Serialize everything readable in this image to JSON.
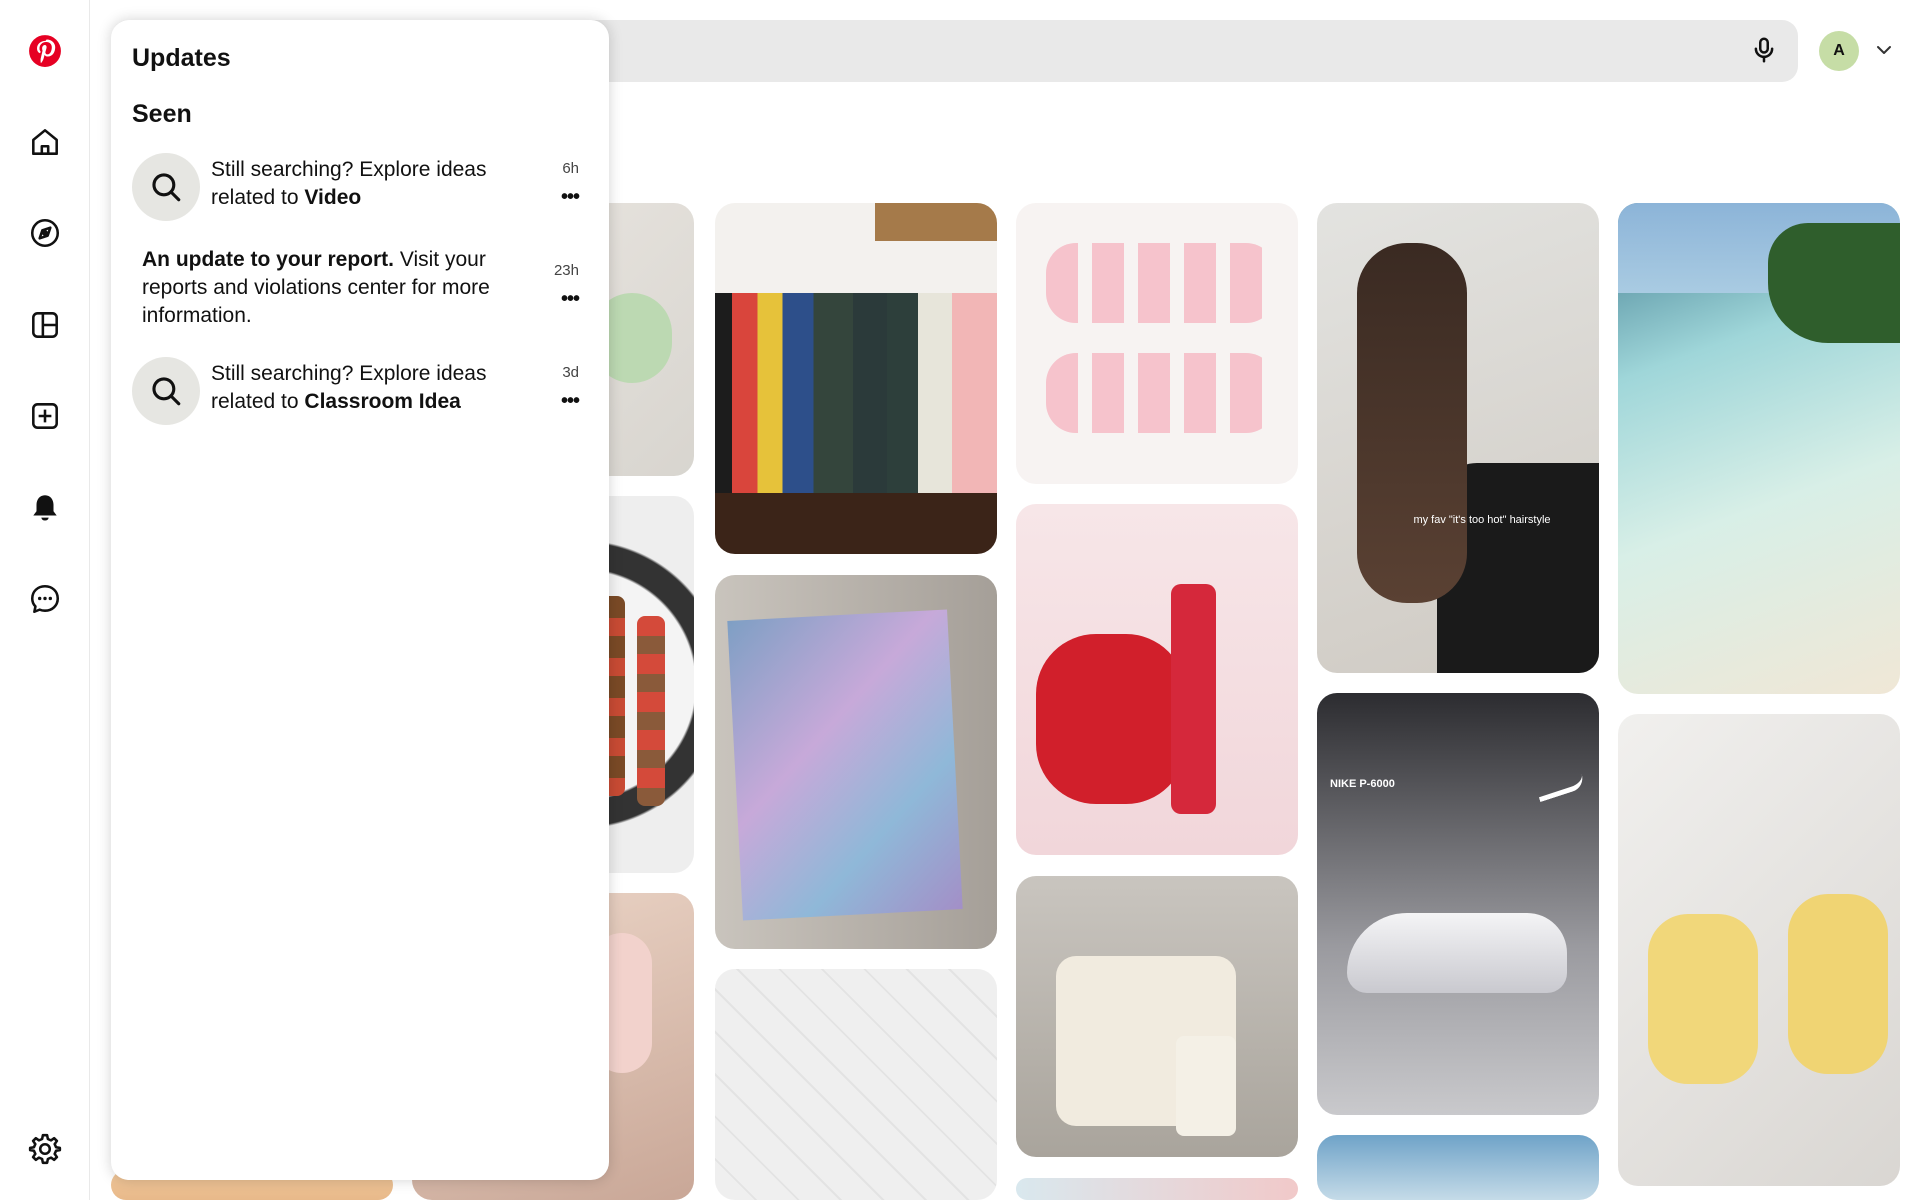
{
  "sidebar": {
    "logo": "pinterest-logo",
    "items": [
      {
        "name": "home",
        "icon": "home-icon"
      },
      {
        "name": "explore",
        "icon": "compass-icon"
      },
      {
        "name": "boards",
        "icon": "boards-icon"
      },
      {
        "name": "create",
        "icon": "plus-square-icon"
      },
      {
        "name": "updates",
        "icon": "bell-icon",
        "active": true
      },
      {
        "name": "messages",
        "icon": "chat-icon"
      }
    ],
    "settings_icon": "gear-icon"
  },
  "header": {
    "mic_icon": "microphone-icon",
    "avatar_initial": "A",
    "chevron_icon": "chevron-down-icon"
  },
  "updates_panel": {
    "title": "Updates",
    "section_heading": "Seen",
    "notifications": [
      {
        "prefix": "Still searching? Explore ideas related to ",
        "bold": "Video",
        "suffix": "",
        "time": "6h",
        "has_icon": true
      },
      {
        "prefix": "",
        "bold": "An update to your report.",
        "suffix": " Visit your reports and violations center for more information.",
        "time": "23h",
        "has_icon": false
      },
      {
        "prefix": "Still searching? Explore ideas related to ",
        "bold": "Classroom Idea",
        "suffix": "",
        "time": "3d",
        "has_icon": true
      }
    ],
    "more_label": "•••"
  },
  "feed": {
    "pins": [
      {
        "label": "",
        "image": "pale green shoes"
      },
      {
        "label": "",
        "image": "skewers on plate"
      },
      {
        "label": "",
        "image": "heart nails"
      },
      {
        "label": "",
        "image": "books on shelf"
      },
      {
        "label": "",
        "image": "cherry blossom painting"
      },
      {
        "label": "",
        "image": "quilted fabric with shells"
      },
      {
        "label": "",
        "image": "strawberry nails"
      },
      {
        "label": "",
        "image": "laneige strawberry lip product"
      },
      {
        "label": "",
        "image": "coach strawberry bag"
      },
      {
        "label": "my fav \"it's too hot\" hairstyle",
        "image": "braided hairstyle"
      },
      {
        "label": "NIKE P-6000",
        "image": "nike sneaker"
      },
      {
        "label": "",
        "image": "food container"
      },
      {
        "label": "",
        "image": "tropical beach"
      },
      {
        "label": "",
        "image": "vanilla protein ice cream"
      }
    ],
    "colors": {
      "brand_red": "#e60023",
      "panel_bg": "#ffffff",
      "search_bg": "#e9e9e9",
      "avatar_bg": "#c6dda6"
    }
  }
}
